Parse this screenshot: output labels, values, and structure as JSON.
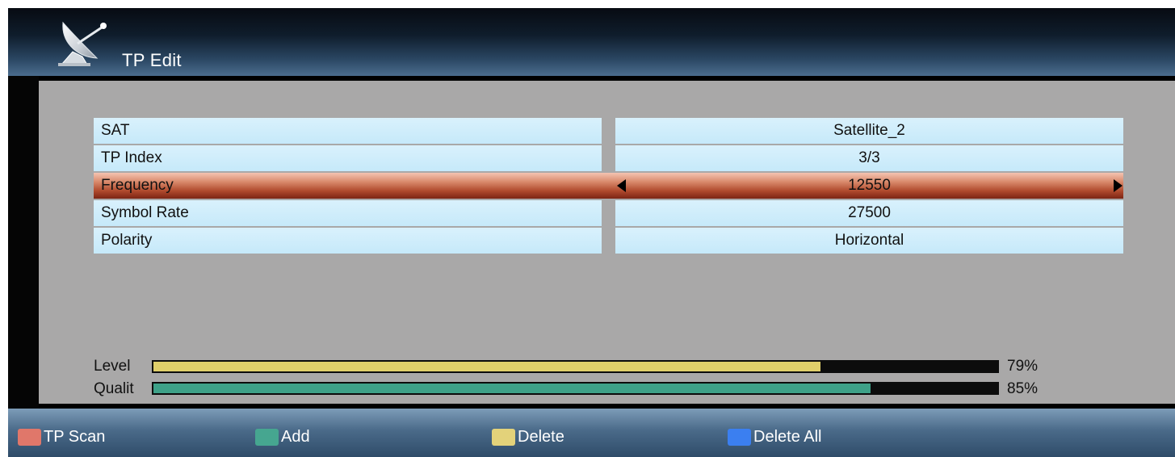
{
  "header": {
    "title": "TP Edit",
    "icon": "satellite-dish-icon"
  },
  "rows": [
    {
      "label": "SAT",
      "value": "Satellite_2"
    },
    {
      "label": "TP Index",
      "value": "3/3"
    },
    {
      "label": "Frequency",
      "value": "12550",
      "selected": true
    },
    {
      "label": "Symbol Rate",
      "value": "27500"
    },
    {
      "label": "Polarity",
      "value": "Horizontal"
    }
  ],
  "signal": {
    "level": {
      "label": "Level",
      "value": 79,
      "display": "79%",
      "color": "#e0cf6a"
    },
    "quality": {
      "label": "Qualit",
      "value": 85,
      "display": "85%",
      "color": "#3ea188"
    }
  },
  "footer": {
    "keys": [
      {
        "label": "TP Scan",
        "color": "#e0776a"
      },
      {
        "label": "Add",
        "color": "#46a690"
      },
      {
        "label": "Delete",
        "color": "#e3d27a"
      },
      {
        "label": "Delete All",
        "color": "#3b7ff0"
      }
    ]
  },
  "colors": {
    "cell_bg": "#c6e9fa",
    "selected_row": "#b04a2d",
    "panel_bg": "#a9a8a8"
  }
}
